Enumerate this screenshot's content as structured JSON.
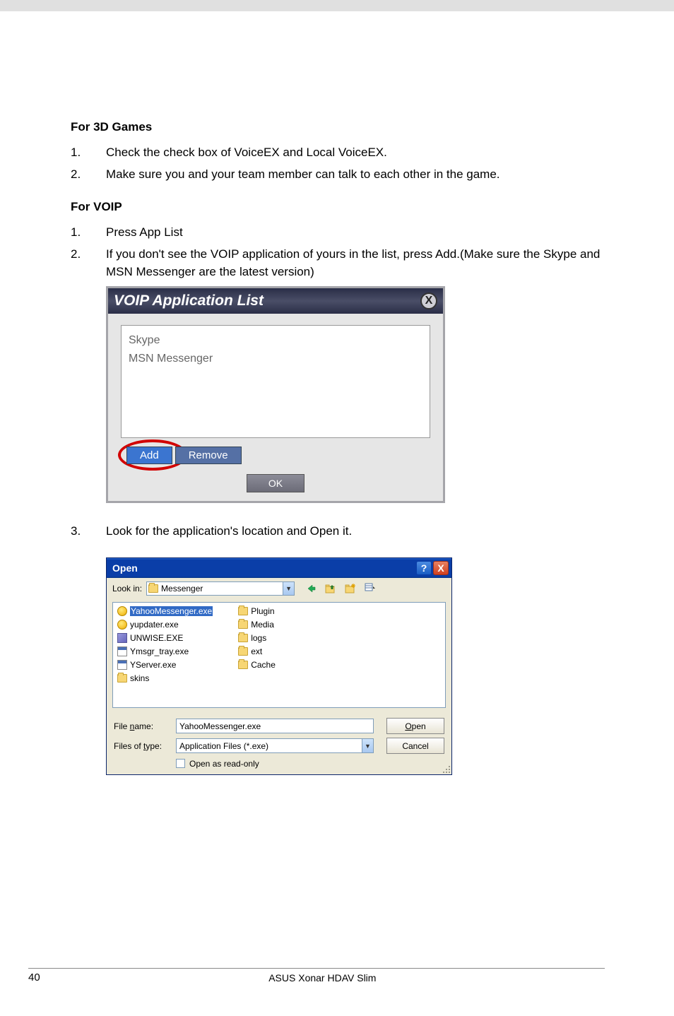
{
  "headings": {
    "games": "For 3D Games",
    "voip": "For VOIP"
  },
  "games_steps": [
    {
      "num": "1.",
      "txt": "Check the check box of VoiceEX and Local VoiceEX."
    },
    {
      "num": "2.",
      "txt": "Make sure you and your team member can talk to each other in the game."
    }
  ],
  "voip_steps_a": [
    {
      "num": "1.",
      "txt": "Press App List"
    },
    {
      "num": "2.",
      "txt": "If you don't see the VOIP application of yours in the list, press Add.(Make sure the Skype and MSN Messenger are the latest version)"
    }
  ],
  "voip_steps_b": [
    {
      "num": "3.",
      "txt": "Look for the application's location and Open it."
    }
  ],
  "voip_window": {
    "title": "VOIP Application List",
    "close": "X",
    "items": [
      "Skype",
      "MSN Messenger"
    ],
    "add": "Add",
    "remove": "Remove",
    "ok": "OK"
  },
  "open_window": {
    "title": "Open",
    "lookin_label": "Look in:",
    "lookin_value": "Messenger",
    "file_col1": [
      {
        "name": "YahooMessenger.exe",
        "icon": "yahoo",
        "selected": true
      },
      {
        "name": "yupdater.exe",
        "icon": "yahoo"
      },
      {
        "name": "UNWISE.EXE",
        "icon": "unwise"
      },
      {
        "name": "Ymsgr_tray.exe",
        "icon": "app"
      },
      {
        "name": "YServer.exe",
        "icon": "app"
      },
      {
        "name": "skins",
        "icon": "folder"
      }
    ],
    "file_col2": [
      {
        "name": "Plugin",
        "icon": "folder"
      },
      {
        "name": "Media",
        "icon": "folder"
      },
      {
        "name": "logs",
        "icon": "folder"
      },
      {
        "name": "ext",
        "icon": "folder"
      },
      {
        "name": "Cache",
        "icon": "folder"
      }
    ],
    "filename_label_pre": "File ",
    "filename_label_ul": "n",
    "filename_label_post": "ame:",
    "filename_value": "YahooMessenger.exe",
    "filetype_label_pre": "Files of ",
    "filetype_label_ul": "t",
    "filetype_label_post": "ype:",
    "filetype_value": "Application Files (*.exe)",
    "open_btn_ul": "O",
    "open_btn_post": "pen",
    "cancel_btn": "Cancel",
    "readonly_pre": "Open as ",
    "readonly_ul": "r",
    "readonly_post": "ead-only",
    "help": "?",
    "close": "X"
  },
  "footer": {
    "page": "40",
    "text": "ASUS Xonar HDAV Slim"
  }
}
